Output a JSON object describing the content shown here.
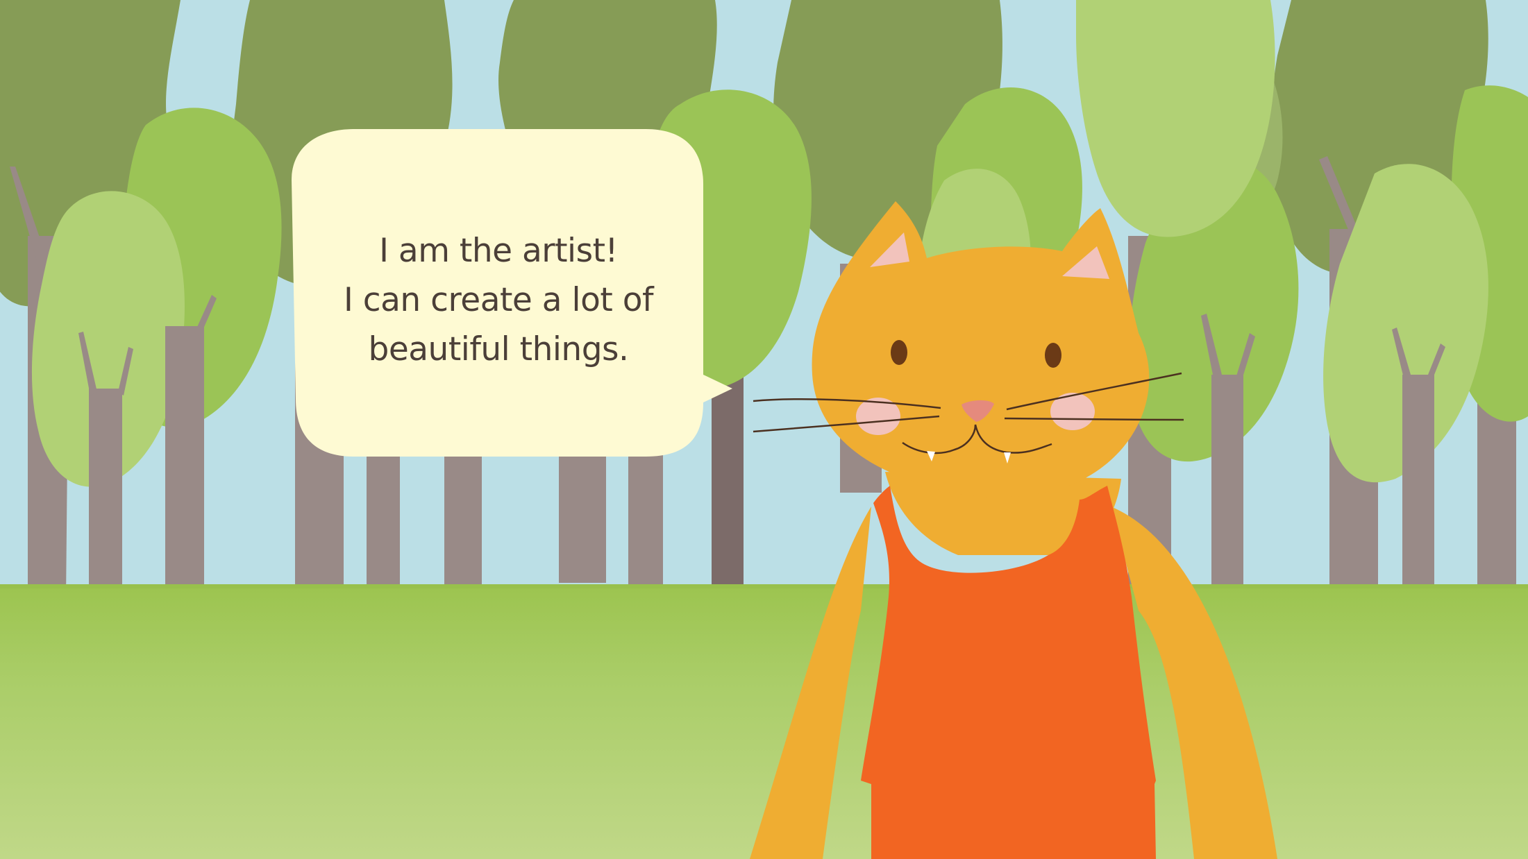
{
  "speech_bubble": {
    "lines": [
      "I am the artist!",
      "I can create a lot of",
      "beautiful things."
    ]
  },
  "characters": {
    "cat": {
      "fur_color": "#efad32",
      "shirt_color": "#f26522",
      "inner_ear_color": "#f2c3bc",
      "nose_color": "#e58a7d",
      "eye_color": "#6b3a16"
    }
  },
  "colors": {
    "sky": "#bbdfe6",
    "grass_top": "#9cc44f",
    "grass_bottom": "#c0d888",
    "tree_dark": "#869c56",
    "tree_mid": "#9bc456",
    "tree_light": "#b1d175",
    "trunk": "#998a87",
    "trunk_dark": "#7c6b69",
    "bubble": "#fefad3",
    "text": "#4b3f38"
  }
}
